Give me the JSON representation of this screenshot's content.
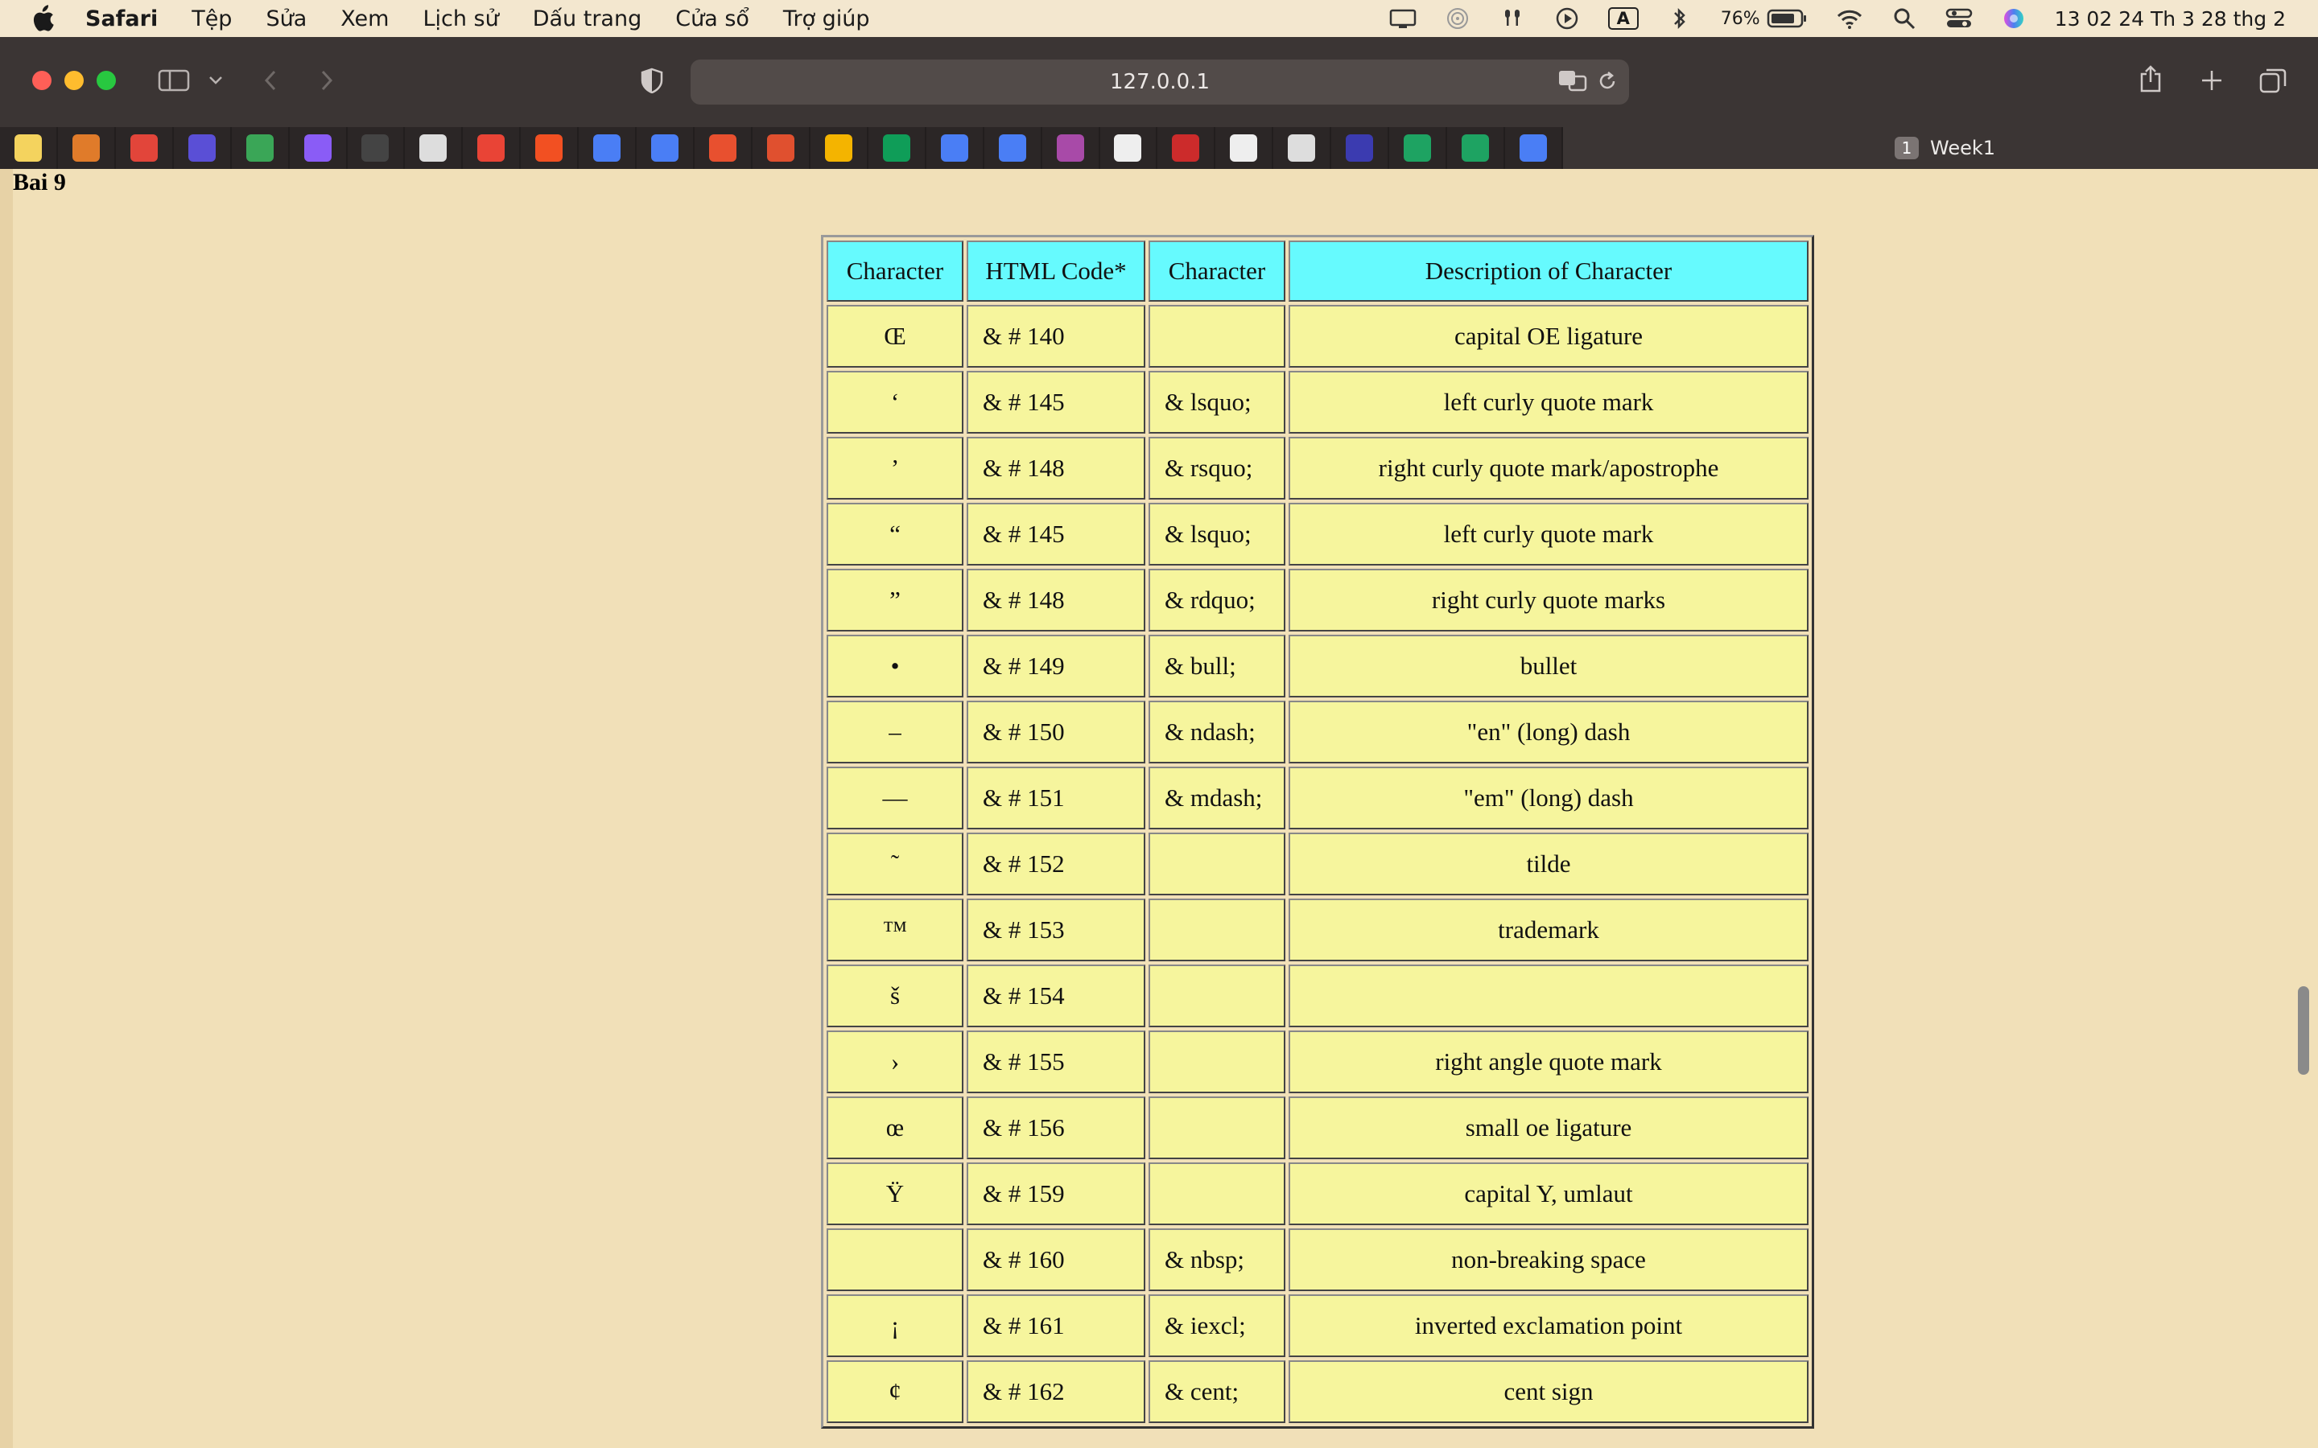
{
  "menubar": {
    "app": "Safari",
    "items": [
      "Tệp",
      "Sửa",
      "Xem",
      "Lịch sử",
      "Dấu trang",
      "Cửa sổ",
      "Trợ giúp"
    ],
    "battery": "76%",
    "input_source": "A",
    "clock": "13 02 24 Th 3 28 thg 2"
  },
  "browser": {
    "url": "127.0.0.1",
    "tab_count": "1",
    "tab_title": "Week1",
    "bookmark_icons": [
      "lightbulb-icon",
      "stack-icon",
      "t-icon",
      "pen-icon",
      "feedly-icon",
      "u-icon",
      "mit-ocw-icon",
      "doc-icon",
      "gmail-icon",
      "microsoft-icon",
      "docs-icon",
      "docs-icon",
      "t-red-icon",
      "figure-icon",
      "drive-icon",
      "drive-icon",
      "docs-icon",
      "docs-icon",
      "dots-icon",
      "horse-icon",
      "waves-icon",
      "g-icon",
      "doc-icon",
      "planet-icon",
      "sheets-icon",
      "sheets-icon",
      "docs-icon"
    ],
    "bookmark_colors": [
      "#f4d35e",
      "#e07b2a",
      "#e2453a",
      "#5a4fd6",
      "#3aa657",
      "#8a5cf6",
      "#444444",
      "#dddddd",
      "#e94436",
      "#f25022",
      "#4a7ef5",
      "#4a7ef5",
      "#e8502f",
      "#e0502f",
      "#f4b400",
      "#0f9d58",
      "#4a7ef5",
      "#4a7ef5",
      "#a84aa8",
      "#eeeeee",
      "#cc2b2b",
      "#eeeeee",
      "#dddddd",
      "#3b3bb0",
      "#1ea362",
      "#1ea362",
      "#4a7ef5"
    ]
  },
  "page": {
    "heading": "Bai 9",
    "table": {
      "headers": [
        "Character",
        "HTML Code*",
        "Character",
        "Description of Character"
      ],
      "rows": [
        [
          "Œ",
          "& # 140",
          "",
          "capital OE ligature"
        ],
        [
          "‘",
          "& # 145",
          "& lsquo;",
          "left curly quote mark"
        ],
        [
          "’",
          "& # 148",
          "& rsquo;",
          "right curly quote mark/apostrophe"
        ],
        [
          "“",
          "& # 145",
          "& lsquo;",
          "left curly quote mark"
        ],
        [
          "”",
          "& # 148",
          "& rdquo;",
          "right curly quote marks"
        ],
        [
          "•",
          "& # 149",
          "& bull;",
          "bullet"
        ],
        [
          "–",
          "& # 150",
          "& ndash;",
          "\"en\" (long) dash"
        ],
        [
          "—",
          "& # 151",
          "& mdash;",
          "\"em\" (long) dash"
        ],
        [
          "˜",
          "& # 152",
          "",
          "tilde"
        ],
        [
          "™",
          "& # 153",
          "",
          "trademark"
        ],
        [
          "š",
          "& # 154",
          "",
          ""
        ],
        [
          "›",
          "& # 155",
          "",
          "right angle quote mark"
        ],
        [
          "œ",
          "& # 156",
          "",
          "small oe ligature"
        ],
        [
          "Ÿ",
          "& # 159",
          "",
          "capital Y, umlaut"
        ],
        [
          "",
          "& # 160",
          "& nbsp;",
          "non-breaking space"
        ],
        [
          "¡",
          "& # 161",
          "& iexcl;",
          "inverted exclamation point"
        ],
        [
          "¢",
          "& # 162",
          "& cent;",
          "cent sign"
        ]
      ]
    }
  }
}
